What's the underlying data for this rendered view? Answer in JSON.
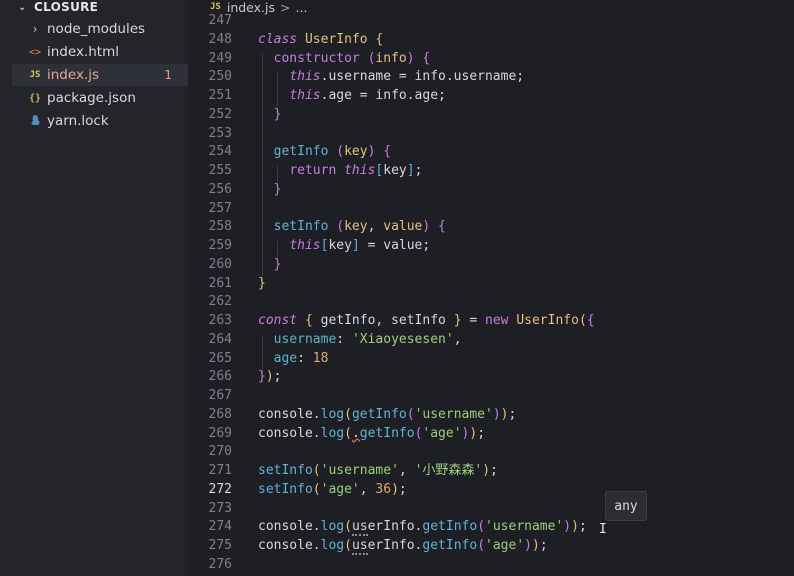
{
  "sidebar": {
    "title": "CLOSURE",
    "items": [
      {
        "name": "node_modules",
        "icon": "chevron-right-icon",
        "glyph": "›"
      },
      {
        "name": "index.html",
        "icon": "html-file-icon",
        "glyph": "<>"
      },
      {
        "name": "index.js",
        "icon": "js-file-icon",
        "glyph": "JS",
        "badge": "1"
      },
      {
        "name": "package.json",
        "icon": "json-file-icon",
        "glyph": "{}"
      },
      {
        "name": "yarn.lock",
        "icon": "yarn-icon",
        "glyph": "🐈"
      }
    ]
  },
  "breadcrumb": {
    "file": "index.js",
    "file_icon": "JS",
    "separator": ">",
    "more": "..."
  },
  "editor": {
    "line_numbers": [
      "247",
      "248",
      "249",
      "250",
      "251",
      "252",
      "253",
      "254",
      "255",
      "256",
      "257",
      "258",
      "259",
      "260",
      "261",
      "262",
      "263",
      "264",
      "265",
      "266",
      "267",
      "268",
      "269",
      "270",
      "271",
      "272",
      "273",
      "274",
      "275",
      "276"
    ],
    "active_line": "272"
  },
  "tooltip": {
    "text": "any"
  },
  "colors": {
    "keyword": "#c77ddb",
    "class": "#e6c07b",
    "function": "#5fb3d9",
    "string": "#9dcf76",
    "number": "#e5a86b",
    "error": "#e06c5a"
  }
}
